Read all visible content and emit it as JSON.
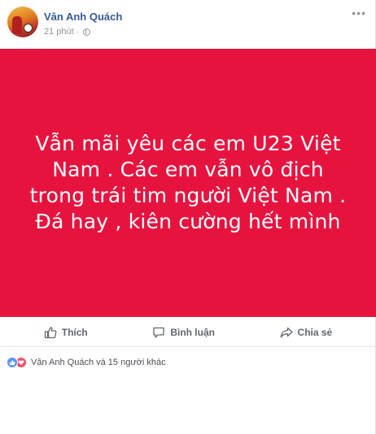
{
  "post": {
    "author": "Vân Anh Quách",
    "time": "21 phút",
    "separator": "·",
    "more_icon": "more-icon",
    "banner_color": "#e7133f",
    "banner_text": "Vẫn mãi yêu các em U23 Việt Nam . Các em vẫn vô địch trong trái tim người Việt Nam . Đá hay , kiên cường hết mình"
  },
  "actions": {
    "like": "Thích",
    "comment": "Bình luận",
    "share": "Chia sẻ"
  },
  "reactions": {
    "summary": "Vân Anh Quách và 15 người khác",
    "icons": [
      "like-icon",
      "love-icon"
    ]
  }
}
